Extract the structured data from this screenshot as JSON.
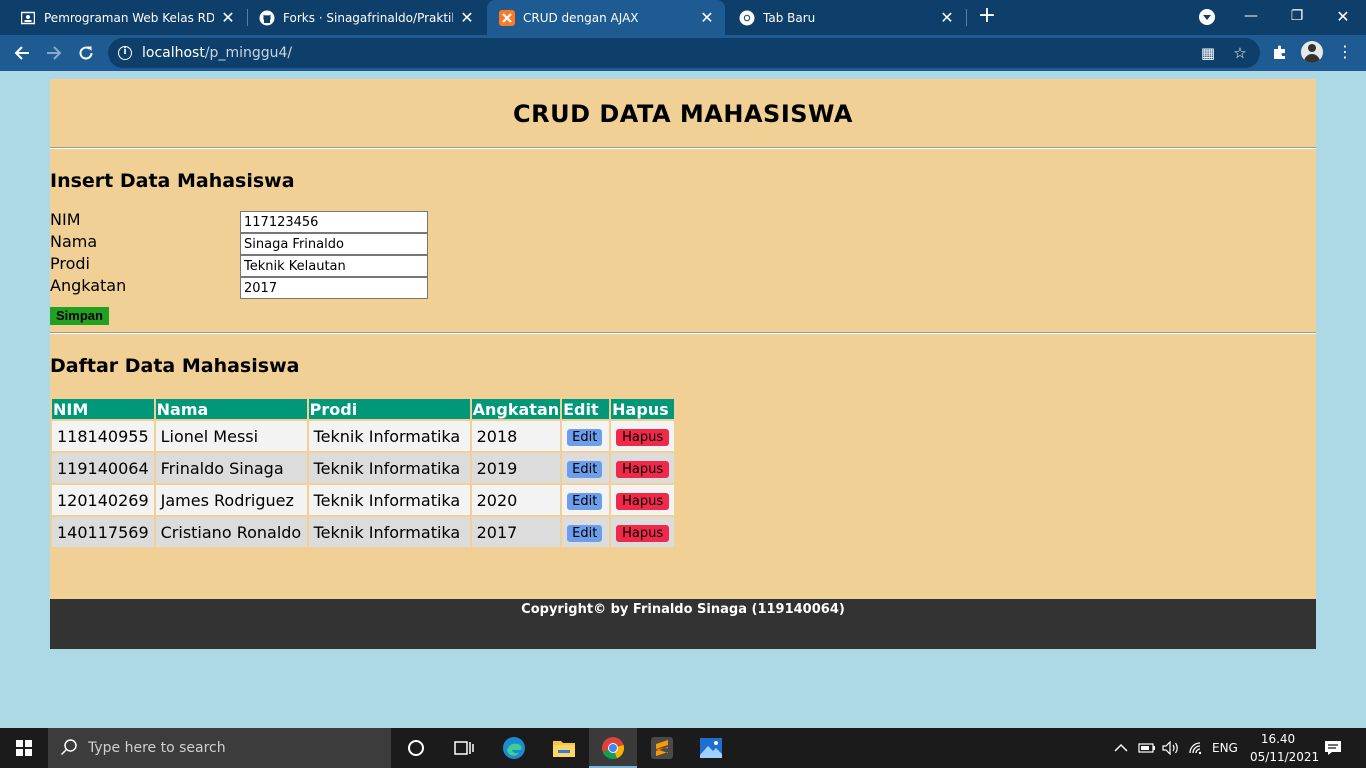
{
  "browser": {
    "tabs": [
      {
        "title": "Pemrograman Web Kelas RD Sem",
        "icon": "classroom-icon",
        "active": false
      },
      {
        "title": "Forks · Sinagafrinaldo/Praktikum",
        "icon": "github-icon",
        "active": false
      },
      {
        "title": "CRUD dengan AJAX",
        "icon": "xampp-icon",
        "active": true
      },
      {
        "title": "Tab Baru",
        "icon": "chrome-icon",
        "active": false
      }
    ],
    "url_host": "localhost",
    "url_path": "/p_minggu4/"
  },
  "page": {
    "title": "CRUD DATA MAHASISWA",
    "insert_title": "Insert Data Mahasiswa",
    "form": {
      "nim_label": "NIM",
      "nim_value": "117123456",
      "nama_label": "Nama",
      "nama_value": "Sinaga Frinaldo",
      "prodi_label": "Prodi",
      "prodi_value": "Teknik Kelautan",
      "angkatan_label": "Angkatan",
      "angkatan_value": "2017",
      "save_label": "Simpan"
    },
    "list_title": "Daftar Data Mahasiswa",
    "table": {
      "headers": [
        "NIM",
        "Nama",
        "Prodi",
        "Angkatan",
        "Edit",
        "Hapus"
      ],
      "rows": [
        {
          "nim": "118140955",
          "nama": "Lionel Messi",
          "prodi": "Teknik Informatika",
          "angkatan": "2018"
        },
        {
          "nim": "119140064",
          "nama": "Frinaldo Sinaga",
          "prodi": "Teknik Informatika",
          "angkatan": "2019"
        },
        {
          "nim": "120140269",
          "nama": "James Rodriguez",
          "prodi": "Teknik Informatika",
          "angkatan": "2020"
        },
        {
          "nim": "140117569",
          "nama": "Cristiano Ronaldo",
          "prodi": "Teknik Informatika",
          "angkatan": "2017"
        }
      ],
      "edit_label": "Edit",
      "hapus_label": "Hapus"
    },
    "footer": "Copyright© by Frinaldo Sinaga (119140064)"
  },
  "taskbar": {
    "search_placeholder": "Type here to search",
    "language": "ENG",
    "time": "16.40",
    "date": "05/11/2021"
  },
  "colors": {
    "page_bg": "#add8e6",
    "content_bg": "#f0d095",
    "table_header": "#009879",
    "save_button": "#22a022",
    "edit_button": "#6d9eeb",
    "hapus_button": "#f0284a",
    "footer_bg": "#333333"
  }
}
